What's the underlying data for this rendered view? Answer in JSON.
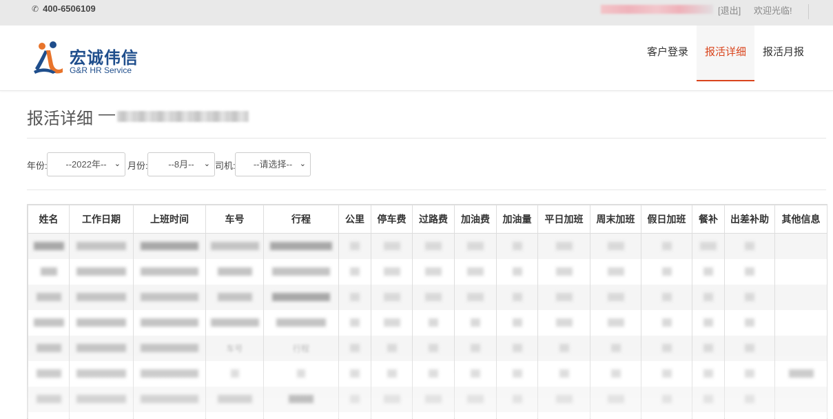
{
  "topbar": {
    "phone_icon": "phone-icon",
    "phone": "400-6506109",
    "logout": "[退出]",
    "welcome": "欢迎光临!"
  },
  "logo": {
    "name_cn": "宏诚伟信",
    "name_en": "G&R HR Service",
    "colors": {
      "blue": "#1f4e8c",
      "orange": "#e8742b",
      "red": "#d9441c"
    }
  },
  "nav": {
    "items": [
      {
        "label": "客户登录",
        "active": false
      },
      {
        "label": "报活详细",
        "active": true
      },
      {
        "label": "报活月报",
        "active": false
      }
    ],
    "accent_color": "#d9441c"
  },
  "page": {
    "title": "报活详细",
    "title_separator": "—"
  },
  "filters": {
    "year_label": "年份:",
    "year_value": "--2022年--",
    "month_label": "月份:",
    "month_value": "--8月--",
    "driver_label": "司机:",
    "driver_value": "--请选择--"
  },
  "table": {
    "headers": [
      "姓名",
      "工作日期",
      "上班时间",
      "车号",
      "行程",
      "公里",
      "停车费",
      "过路费",
      "加油费",
      "加油量",
      "平日加班",
      "周末加班",
      "假日加班",
      "餐补",
      "出差补助",
      "其他信息"
    ],
    "visible_cells": {
      "row5_trip": "行程",
      "row5_car": "车号"
    }
  }
}
